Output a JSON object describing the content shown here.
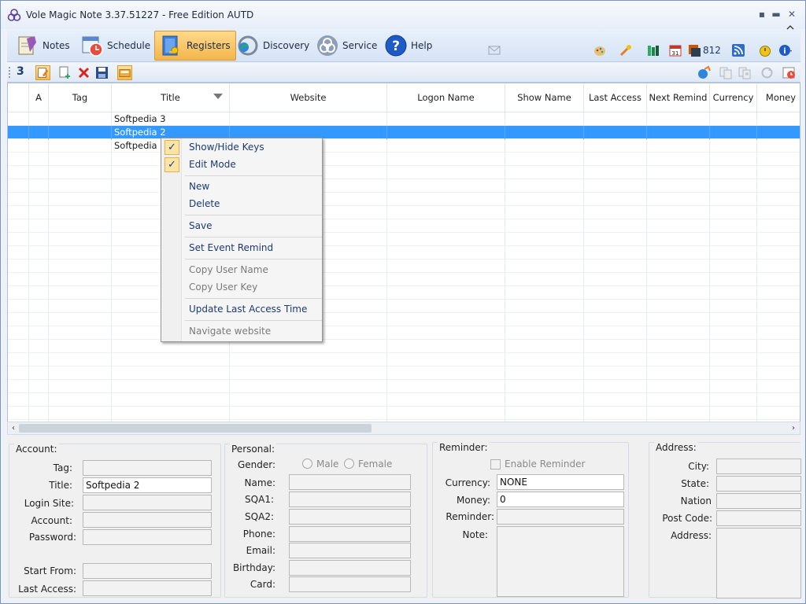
{
  "window": {
    "title": "Vole Magic Note  3.37.51227 - Free Edition AUTD",
    "controls": {
      "minimize": "▪",
      "restore": "▬",
      "close": "✕"
    }
  },
  "ribbon": {
    "buttons": [
      {
        "label": "Notes",
        "icon": "notes-icon"
      },
      {
        "label": "Schedule",
        "icon": "schedule-icon"
      },
      {
        "label": "Registers",
        "icon": "registers-icon",
        "active": true
      },
      {
        "label": "Discovery",
        "icon": "discovery-icon"
      },
      {
        "label": "Service",
        "icon": "service-icon"
      },
      {
        "label": "Help",
        "icon": "help-icon"
      }
    ],
    "counter": "812",
    "colors": {
      "active_bg": "#f3b64d",
      "ribbon_bg": "#d6e4f5"
    }
  },
  "toolbar": {
    "count": "3"
  },
  "grid": {
    "columns": [
      "A",
      "Tag",
      "Title",
      "Website",
      "Logon Name",
      "Show Name",
      "Last Access",
      "Next Remind",
      "Currency",
      "Money"
    ],
    "rows": [
      {
        "title": "Softpedia 3",
        "selected": false
      },
      {
        "title": "Softpedia 2",
        "selected": true
      },
      {
        "title": "Softpedia",
        "selected": false
      }
    ],
    "selection_color": "#3399ff"
  },
  "context_menu": {
    "items": {
      "show_hide_keys": "Show/Hide Keys",
      "edit_mode": "Edit Mode",
      "new": "New",
      "delete": "Delete",
      "save": "Save",
      "set_event_remind": "Set Event Remind",
      "copy_user_name": "Copy User Name",
      "copy_user_key": "Copy User Key",
      "update_last_access_time": "Update Last Access Time",
      "navigate_website": "Navigate website"
    },
    "check": "✓"
  },
  "form": {
    "account": {
      "title": "Account:",
      "tag_label": "Tag:",
      "title_label": "Title:",
      "title_value": "Softpedia 2",
      "login_site_label": "Login Site:",
      "account_label": "Account:",
      "password_label": "Password:",
      "start_from_label": "Start From:",
      "last_access_label": "Last Access:"
    },
    "personal": {
      "title": "Personal:",
      "gender_label": "Gender:",
      "male": "Male",
      "female": "Female",
      "name_label": "Name:",
      "sqa1_label": "SQA1:",
      "sqa2_label": "SQA2:",
      "phone_label": "Phone:",
      "email_label": "Email:",
      "birthday_label": "Birthday:",
      "card_label": "Card:"
    },
    "reminder": {
      "title": "Reminder:",
      "enable_label": "Enable Reminder",
      "currency_label": "Currency:",
      "currency_value": "NONE",
      "money_label": "Money:",
      "money_value": "0",
      "reminder_label": "Reminder:",
      "note_label": "Note:"
    },
    "address": {
      "title": "Address:",
      "city_label": "City:",
      "state_label": "State:",
      "nation_label": "Nation",
      "post_code_label": "Post Code:",
      "address_label": "Address:"
    }
  }
}
